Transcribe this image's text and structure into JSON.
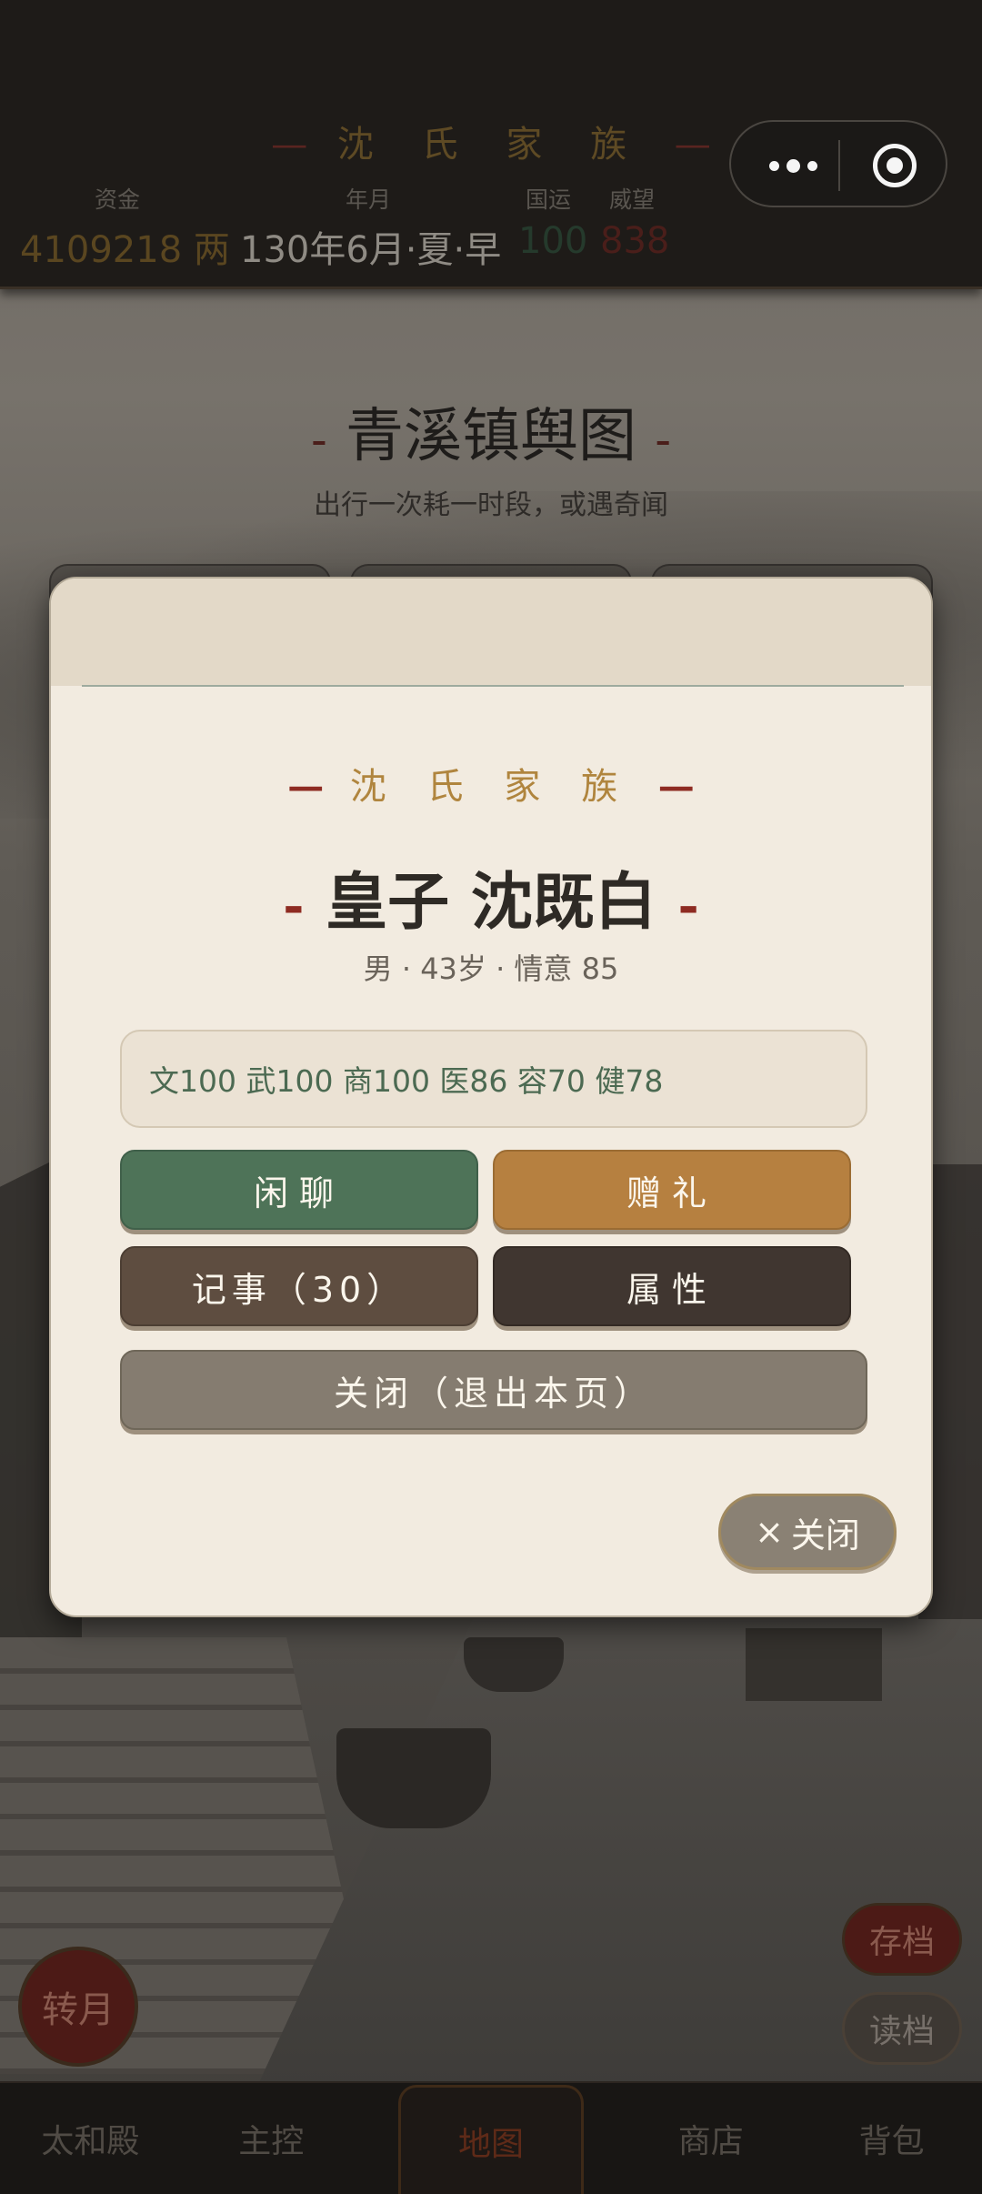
{
  "topbar": {
    "family_title": "沈 氏 家 族",
    "title_dash": "—",
    "labels": {
      "funds": "资金",
      "date": "年月",
      "fortune": "国运",
      "prestige": "威望"
    },
    "values": {
      "funds": "4109218 两",
      "date": "130年6月·夏·早",
      "fortune": "100",
      "prestige": "838"
    }
  },
  "map": {
    "title": "青溪镇舆图",
    "subtitle": "出行一次耗一时段，或遇奇闻"
  },
  "modal": {
    "family": "沈 氏 家 族",
    "name": "皇子 沈既白",
    "meta": "男 · 43岁 · 情意 85",
    "attributes": "文100 武100 商100 医86 容70 健78",
    "buttons": {
      "chat": "闲聊",
      "gift": "赠礼",
      "notes": "记事（30）",
      "attributes": "属性",
      "close_page": "关闭（退出本页）"
    },
    "close_pill": "关闭",
    "close_glyph": "×"
  },
  "controls": {
    "turn_month": "转月",
    "save": "存档",
    "load": "读档"
  },
  "tabs": [
    "太和殿",
    "主控",
    "地图",
    "商店",
    "背包"
  ],
  "active_tab": "地图",
  "colors": {
    "accent_gold": "#b0853e",
    "accent_red": "#8e2b22",
    "green_button": "#4e7358",
    "gold_button": "#b68040",
    "brown_button": "#5e4d40",
    "dark_button": "#403630",
    "grey_button": "#857c70",
    "modal_bg": "#f2ebe0"
  },
  "icons": {
    "more": "three-dots-icon",
    "miniapp_close": "target-circle-icon",
    "close": "x-icon"
  }
}
